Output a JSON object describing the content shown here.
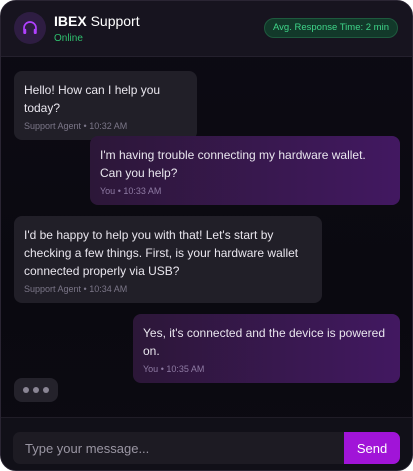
{
  "header": {
    "icon": "headset-icon",
    "brand_bold": "IBEX",
    "brand_rest": " Support",
    "status": "Online",
    "response_badge": "Avg. Response Time: 2 min"
  },
  "messages": [
    {
      "sender": "agent",
      "text": "Hello! How can I help you today?",
      "meta": "Support Agent • 10:32 AM"
    },
    {
      "sender": "user",
      "text": "I'm having trouble connecting my hardware wallet. Can you help?",
      "meta": "You • 10:33 AM"
    },
    {
      "sender": "agent",
      "text": "I'd be happy to help you with that! Let's start by checking a few things. First, is your hardware wallet connected properly via USB?",
      "meta": "Support Agent • 10:34 AM"
    },
    {
      "sender": "user",
      "text": "Yes, it's connected and the device is powered on.",
      "meta": "You • 10:35 AM"
    }
  ],
  "typing_indicator": "typing-dots-icon",
  "composer": {
    "placeholder": "Type your message...",
    "send_label": "Send"
  },
  "colors": {
    "accent": "#a114d8",
    "online": "#2fc06e",
    "agent_bubble": "#211f28",
    "user_bubble": "#421861"
  }
}
